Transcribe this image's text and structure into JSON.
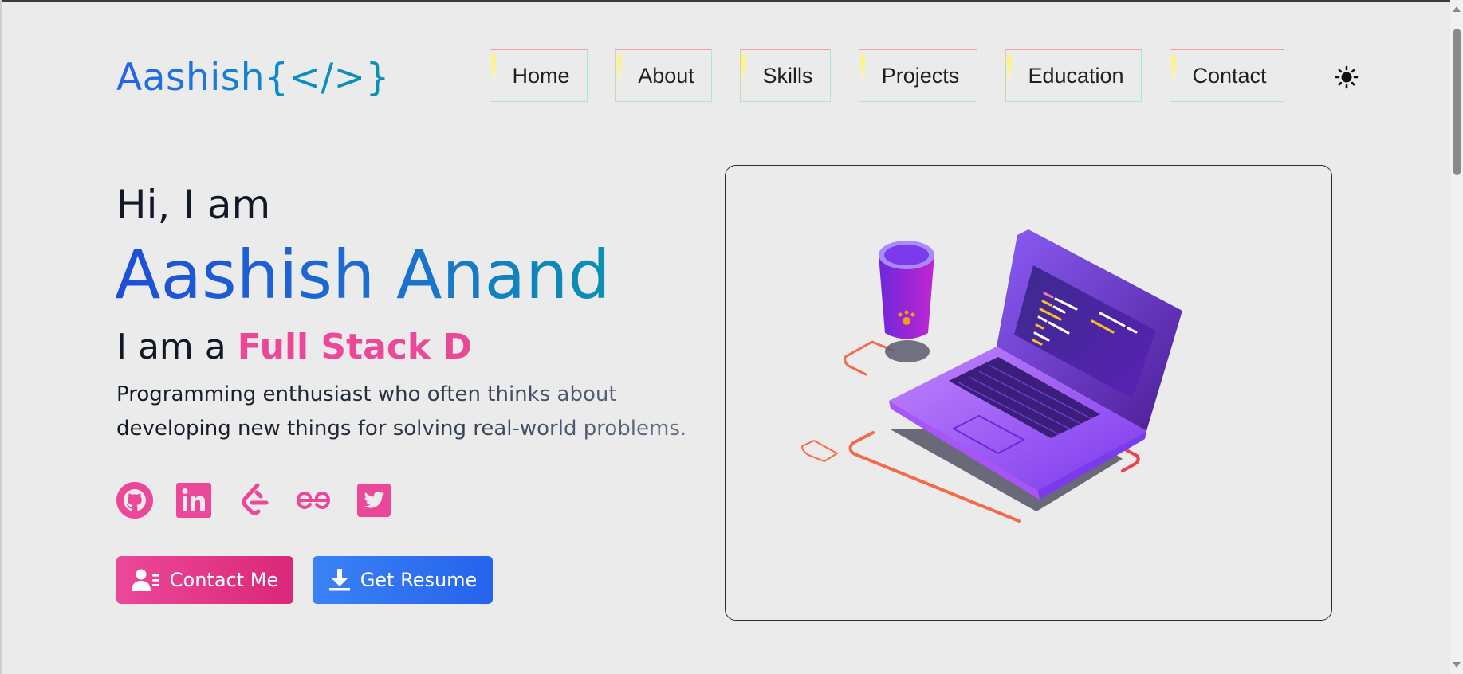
{
  "logo": {
    "text": "Aashish{</>}"
  },
  "nav": {
    "items": [
      {
        "label": "Home"
      },
      {
        "label": "About"
      },
      {
        "label": "Skills"
      },
      {
        "label": "Projects"
      },
      {
        "label": "Education"
      },
      {
        "label": "Contact"
      }
    ],
    "theme_toggle_icon": "sun-icon"
  },
  "hero": {
    "greeting": "Hi, I am",
    "name": "Aashish Anand",
    "role_prefix": "I am a",
    "role_typed": "Full Stack D",
    "description": "Programming enthusiast who often thinks about developing new things for solving real-world problems.",
    "social_icons": [
      "github-icon",
      "linkedin-icon",
      "leetcode-icon",
      "geeksforgeeks-icon",
      "twitter-icon"
    ],
    "buttons": {
      "contact": "Contact Me",
      "resume": "Get Resume"
    }
  },
  "colors": {
    "accent_pink": "#ec4899",
    "accent_blue": "#2563eb",
    "background": "#ebebeb"
  }
}
